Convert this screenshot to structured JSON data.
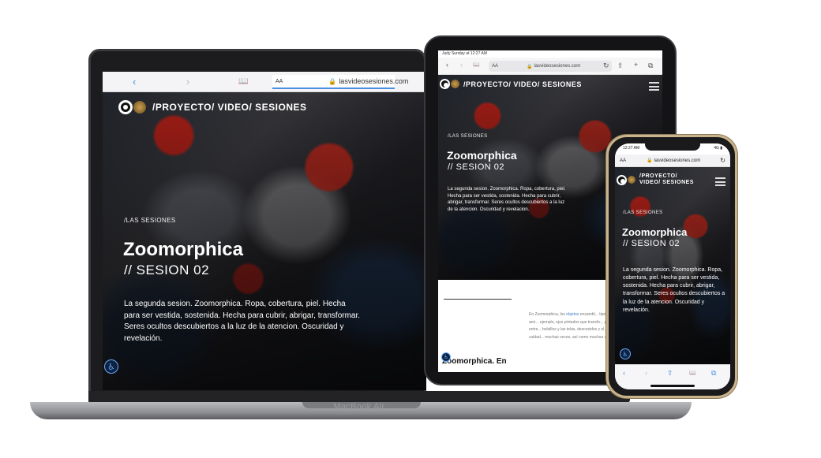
{
  "laptop": {
    "browser": {
      "back": "‹",
      "forward": "›",
      "bookmarks": "📖",
      "text_size": "AA",
      "lock": "🔒",
      "domain": "lasvideosesiones.com"
    },
    "site_title": "/PROYECTO/ VIDEO/ SESIONES",
    "kicker": "/LAS SESIONES",
    "title": "Zoomorphica",
    "subtitle": "// SESION 02",
    "description": "La segunda sesion. Zoomorphica. Ropa, cobertura, piel. Hecha para ser vestida, sostenida. Hecha para cubrir, abrigar, transformar. Seres ocultos descubiertos a la luz de la atencion. Oscuridad y revelación.",
    "accessibility_icon": "♿",
    "brand_label": "MacBook Air"
  },
  "tablet": {
    "status_left": "Judy Sunday at 12:27 AM",
    "browser": {
      "back": "‹",
      "forward": "›",
      "bookmarks": "📖",
      "text_size": "AA",
      "lock": "🔒",
      "domain": "lasvideosesiones.com",
      "reload": "↻",
      "share": "⇪",
      "add": "+",
      "tabs": "⧉"
    },
    "site_title": "/PROYECTO/ VIDEO/ SESIONES",
    "kicker": "/LAS SESIONES",
    "title": "Zoomorphica",
    "subtitle": "// SESION 02",
    "description": "La segunda sesion. Zoomorphica. Ropa, cobertura, piel. Hecha para ser vestida, sostenida. Hecha para cubrir, abrigar, transformar. Seres ocultos descubiertos a la luz de la atencion. Oscuridad y revelacion.",
    "body_intro": "En Zoomorphica, los",
    "body_link": "objetos",
    "body_rest": "ensambl... tipo, pescan rasgos animados o anó... ejemplo, ojos pintados que transfo... presencia, un animismo oculto entre... bolsillos y las telas, descosidos y ol... Hechos de manera artesanal y cuidad... muchas veces, así como muchas vece... lo que ofrece la",
    "footer_title": "Zoomorphica. En",
    "accessibility_icon": "♿"
  },
  "phone": {
    "status_time": "12:27 AM",
    "status_right": "4G ▮",
    "browser": {
      "text_size": "AA",
      "lock": "🔒",
      "domain": "lasvideosesiones.com",
      "reload": "↻"
    },
    "site_title": "/PROYECTO/ VIDEO/ SESIONES",
    "kicker": "/LAS SESIONES",
    "title": "Zoomorphica",
    "subtitle": "// SESION 02",
    "description": "La segunda sesion. Zoomorphica. Ropa, cobertura, piel. Hecha para ser vestida, sostenida. Hecha para cubrir, abrigar, transformar. Seres ocultos descubiertos a la luz de la atencion. Oscuridad y revelación.",
    "accessibility_icon": "♿",
    "toolbar": {
      "back": "‹",
      "forward": "›",
      "share": "⇪",
      "bookmarks": "📖",
      "tabs": "⧉"
    }
  },
  "colors": {
    "accent_blue": "#4a90e2",
    "accent_red": "#e0281e"
  }
}
